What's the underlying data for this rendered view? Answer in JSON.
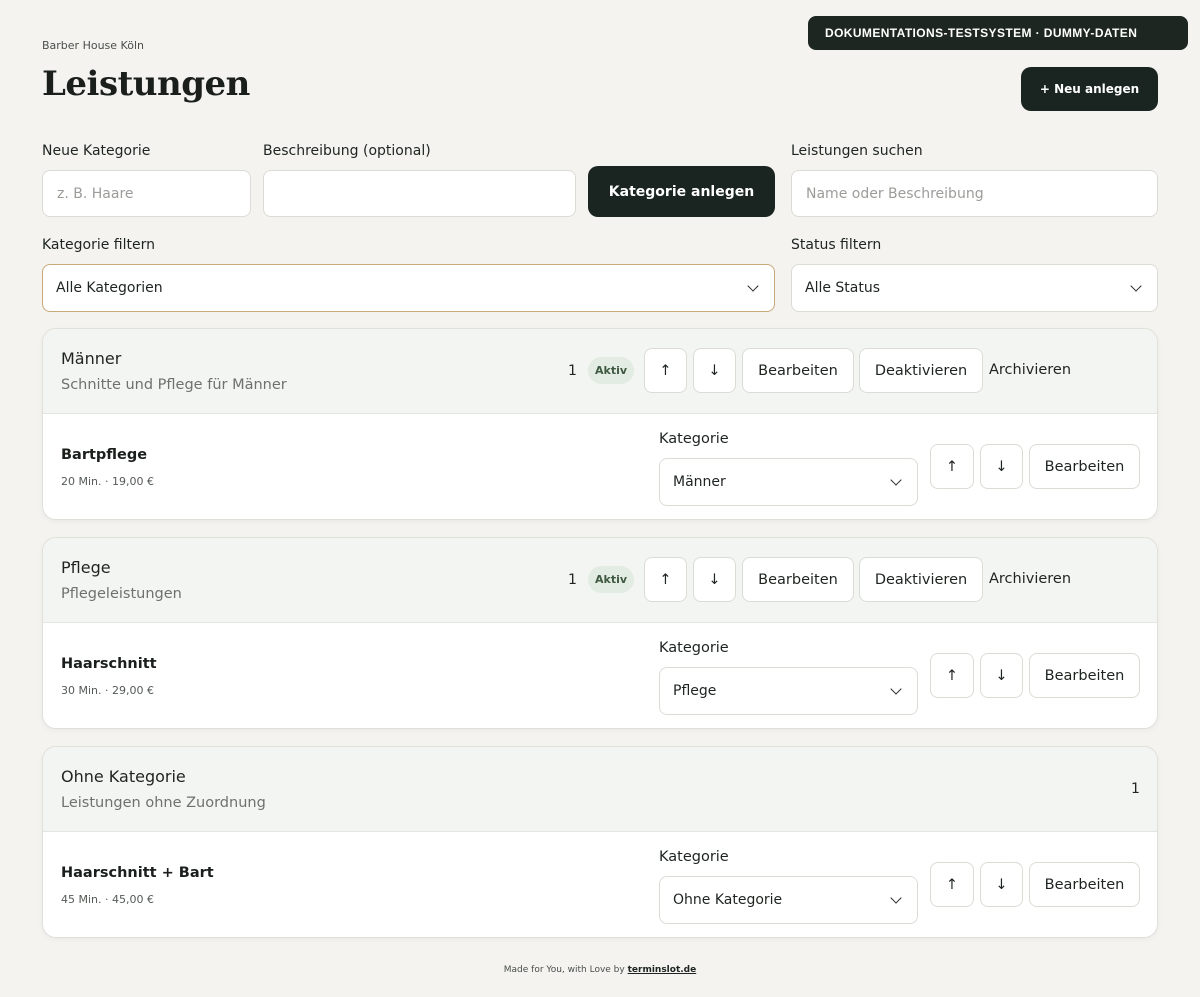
{
  "banner": "DOKUMENTATIONS-TESTSYSTEM · DUMMY-DATEN",
  "shop_name": "Barber House Köln",
  "page_title": "Leistungen",
  "new_button": "+ Neu anlegen",
  "form": {
    "new_category_label": "Neue Kategorie",
    "new_category_placeholder": "z. B. Haare",
    "description_label": "Beschreibung (optional)",
    "description_value": "",
    "create_category_button": "Kategorie anlegen",
    "search_label": "Leistungen suchen",
    "search_placeholder": "Name oder Beschreibung",
    "category_filter_label": "Kategorie filtern",
    "category_filter_value": "Alle Kategorien",
    "status_filter_label": "Status filtern",
    "status_filter_value": "Alle Status"
  },
  "actions": {
    "up": "↑",
    "down": "↓",
    "edit": "Bearbeiten",
    "deactivate": "Deaktivieren",
    "archive": "Archivieren",
    "kategorie_label": "Kategorie"
  },
  "categories": [
    {
      "name": "Männer",
      "description": "Schnitte und Pflege für Männer",
      "count": "1",
      "status": "Aktiv",
      "service": {
        "name": "Bartpflege",
        "meta": "20 Min. · 19,00 €",
        "category": "Männer"
      }
    },
    {
      "name": "Pflege",
      "description": "Pflegeleistungen",
      "count": "1",
      "status": "Aktiv",
      "service": {
        "name": "Haarschnitt",
        "meta": "30 Min. · 29,00 €",
        "category": "Pflege"
      }
    },
    {
      "name": "Ohne Kategorie",
      "description": "Leistungen ohne Zuordnung",
      "count": "1",
      "service": {
        "name": "Haarschnitt + Bart",
        "meta": "45 Min. · 45,00 €",
        "category": "Ohne Kategorie"
      }
    }
  ],
  "footer": {
    "text": "Made for You, with Love by",
    "link": "terminslot.de"
  },
  "colors": {
    "accent": "#1a2420",
    "background": "#f4f3ef",
    "badge_bg": "#e3ece2",
    "badge_text": "#3f5a42"
  }
}
